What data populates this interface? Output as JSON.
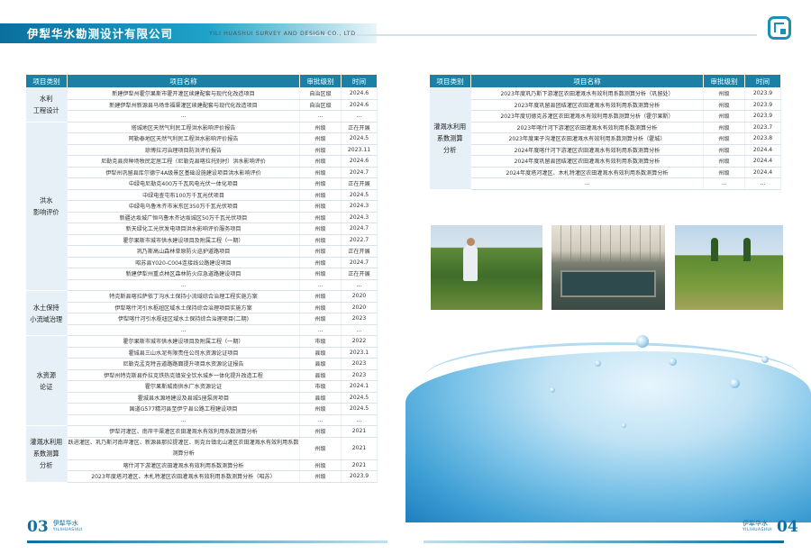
{
  "header": {
    "company_cn": "伊犁华水勘测设计有限公司",
    "company_en": "YILI HUASHUI SURVEY AND DESIGN CO., LTD"
  },
  "table_headers": [
    "项目类别",
    "项目名称",
    "审批级别",
    "时间"
  ],
  "left_table": {
    "groups": [
      {
        "category": "水利\n工程设计",
        "rows": [
          [
            "新建伊犁州霍尔果斯市霍开灌区续建配套与现代化改造项目",
            "自治区级",
            "2024.6"
          ],
          [
            "新建伊犁州新源县马场幸福渠灌区续建配套与现代化改造项目",
            "自治区级",
            "2024.6"
          ],
          [
            "…",
            "…",
            "…"
          ]
        ]
      },
      {
        "category": "洪水\n影响评价",
        "rows": [
          [
            "塔城地区天然气利民工程洪水影响评价报告",
            "州级",
            "正在开展"
          ],
          [
            "阿勒泰地区天然气利民工程洪水影响评价报告",
            "州级",
            "2024.5"
          ],
          [
            "琼博拉河治理项目防洪评价报告",
            "州级",
            "2023.11"
          ],
          [
            "尼勒克县良种场牧民定居工程（尼勒克县喀拉托别村）洪水影响评价",
            "州级",
            "2024.6"
          ],
          [
            "伊犁州巩留县库尔德宁4A级景区基础设施建设项目洪水影响评价",
            "州级",
            "2024.7"
          ],
          [
            "中绿电尼勒克400万千瓦风电光伏一体化项目",
            "州级",
            "正在开展"
          ],
          [
            "中绿电查屯布100万千瓦光伏项目",
            "州级",
            "2024.5"
          ],
          [
            "中绿电乌鲁木齐市米东区350万千瓦光伏项目",
            "州级",
            "2024.3"
          ],
          [
            "新疆达坂城广恒乌鲁木齐达坂城区50万千瓦光伏项目",
            "州级",
            "2024.3"
          ],
          [
            "新天绿化工光伏发电项目洪水影响评价服务项目",
            "州级",
            "2024.7"
          ],
          [
            "霍尔果斯市城市供水建设项目及附属工程（一期）",
            "州级",
            "2022.7"
          ],
          [
            "巩乃斯高山森林草原防火巡护道路项目",
            "州级",
            "正在开展"
          ],
          [
            "昭苏县Y020-C004连接线公路建设项目",
            "州级",
            "2024.7"
          ],
          [
            "新建伊犁州重点林区森林防火应急道路建设项目",
            "州级",
            "正在开展"
          ],
          [
            "…",
            "…",
            "…"
          ]
        ]
      },
      {
        "category": "水土保持\n小流域治理",
        "rows": [
          [
            "特克斯县喀拉萨依丁沟水土保持小流域综合治理工程实施方案",
            "州级",
            "2020"
          ],
          [
            "伊犁喀什河引水枢纽区域水土保持综合治理项目实施方案",
            "州级",
            "2020"
          ],
          [
            "伊犁喀什河引水枢纽区域水土保持综合治理项目(二期)",
            "州级",
            "2023"
          ],
          [
            "…",
            "…",
            "…"
          ]
        ]
      },
      {
        "category": "水资源\n论证",
        "rows": [
          [
            "霍尔果斯市城市供水建设项目及附属工程（一期）",
            "市级",
            "2022"
          ],
          [
            "霍城县三山水泥有限责任公司水资源论证项目",
            "县级",
            "2023.1"
          ],
          [
            "尼勒克孟克特吉道路路面提升项目水资源论证报告",
            "县级",
            "2023"
          ],
          [
            "伊犁州特克斯县乔拉克铁热克镇安全饮水城乡一体化提升改造工程",
            "县级",
            "2023"
          ],
          [
            "霍尔果斯城南供水厂水资源论证",
            "市级",
            "2024.1"
          ],
          [
            "霍城县水源地建设及县城5座泵房项目",
            "县级",
            "2024.5"
          ],
          [
            "国道G577精河县至伊宁县公路工程建设项目",
            "州级",
            "2024.5"
          ],
          [
            "…",
            "…",
            "…"
          ]
        ]
      },
      {
        "category": "灌溉水利用\n系数测算\n分析",
        "rows": [
          [
            "伊犁河灌区、南岸干渠灌区农田灌溉水有效利用系数测算分析",
            "州级",
            "2021"
          ],
          [
            "跃进灌区、巩乃斯河南岸灌区、新源县那拉提灌区、则克台镇北山灌区农田灌溉水有效利用系数测算分析",
            "州级",
            "2021"
          ],
          [
            "喀什河下游灌区农田灌溉水有效利用系数测算分析",
            "州级",
            "2021"
          ],
          [
            "2023年度塔河灌区、木札特灌区农田灌溉水有效利用系数测算分析（昭苏）",
            "州级",
            "2023.9"
          ]
        ]
      }
    ]
  },
  "right_table": {
    "category": "灌溉水利用\n系数测算\n分析",
    "rows": [
      [
        "2023年度巩乃斯下游灌区农田灌溉水有效利用系数测算分析（巩留处）",
        "州级",
        "2023.9"
      ],
      [
        "2023年度巩留县团结灌区农田灌溉水有效利用系数测算分析",
        "州级",
        "2023.9"
      ],
      [
        "2023年度切德克苏灌区农田灌溉水有效利用系数测算分析（霍尔果斯）",
        "州级",
        "2023.9"
      ],
      [
        "2023年喀什河下游灌区农田灌溉水有效利用系数测算分析",
        "州级",
        "2023.7"
      ],
      [
        "2023年度果子沟灌区农田灌溉水有效利用系数测算分析（霍城）",
        "州级",
        "2023.8"
      ],
      [
        "2024年度喀什河下游灌区农田灌溉水有效利用系数测算分析",
        "州级",
        "2024.4"
      ],
      [
        "2024年度巩留县团结灌区农田灌溉水有效利用系数测算分析",
        "州级",
        "2024.4"
      ],
      [
        "2024年度塔河灌区、木札特灌区农田灌溉水有效利用系数测算分析",
        "州级",
        "2024.4"
      ],
      [
        "…",
        "…",
        "…"
      ]
    ]
  },
  "footer": {
    "left_page": "03",
    "right_page": "04",
    "brand_cn": "伊犁华水",
    "brand_en": "YILIHUASHUI"
  }
}
